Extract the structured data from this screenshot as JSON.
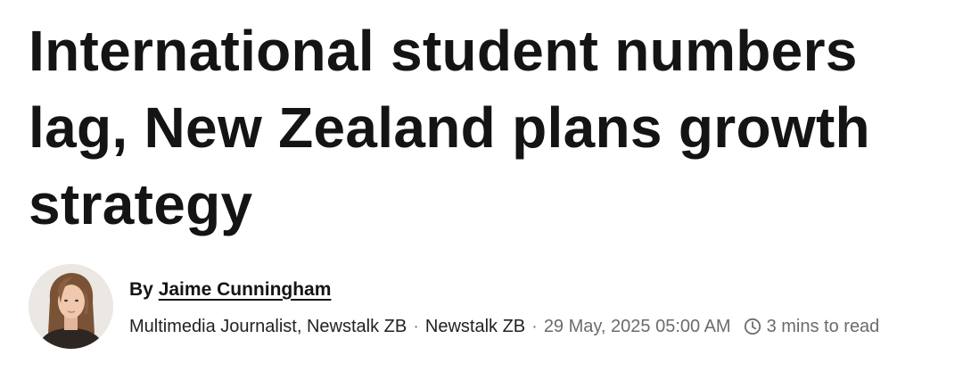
{
  "article": {
    "headline": "International student numbers lag, New Zealand plans growth strategy"
  },
  "byline": {
    "prefix": "By",
    "author": "Jaime Cunningham",
    "role": "Multimedia Journalist, Newstalk ZB",
    "separator": "·",
    "publication": "Newstalk ZB",
    "date": "29 May, 2025 05:00 AM",
    "read_time": "3 mins to read",
    "icons": {
      "avatar": "author-avatar",
      "clock": "clock-icon"
    }
  }
}
